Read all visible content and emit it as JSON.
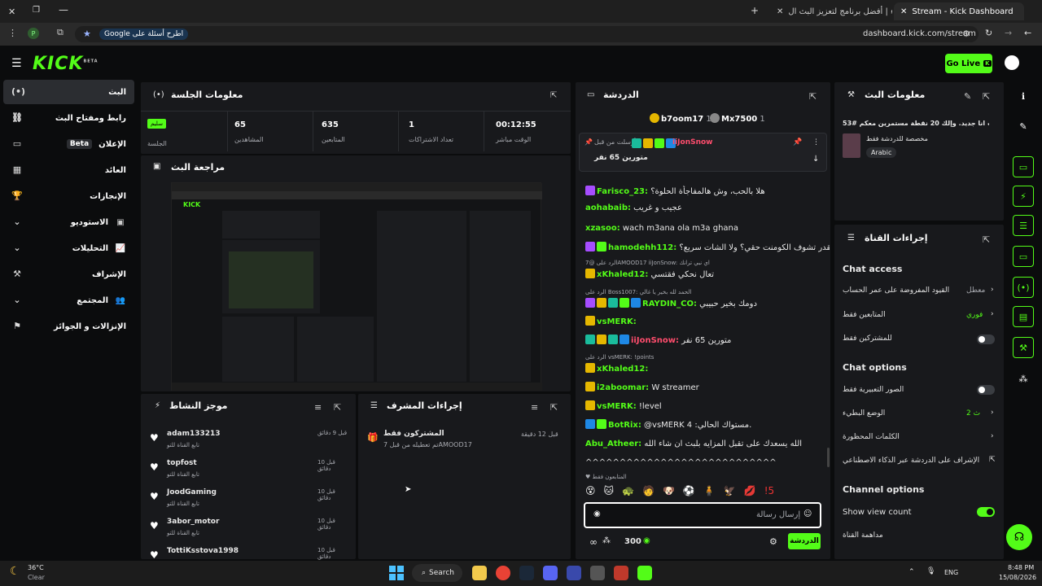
{
  "browser": {
    "tabs": [
      {
        "label": "Stream - Kick Dashboard",
        "active": true
      },
      {
        "label": "الولاء | أفضل برنامج لتعزيز البث ال",
        "active": false
      }
    ],
    "url": "dashboard.kick.com/stream",
    "search_chip": "Google اطرح أسئلة على",
    "profile_initial": "P"
  },
  "header": {
    "logo": "KICK",
    "logo_sup": "BETA",
    "go_live": "Go Live"
  },
  "sidebar": {
    "items": [
      {
        "label": "البث",
        "active": true
      },
      {
        "label": "رابط ومفتاح البث"
      },
      {
        "label": "الإعلان",
        "badge": "Beta"
      },
      {
        "label": "العائد"
      },
      {
        "label": "الإنجازات"
      },
      {
        "label": "الاستوديو"
      },
      {
        "label": "التحليلات"
      },
      {
        "label": "الإشراف"
      },
      {
        "label": "المجتمع"
      },
      {
        "label": "الإنزالات و الجوائز"
      }
    ]
  },
  "session": {
    "title": "معلومات الجلسة",
    "status_badge": "سليم",
    "status_label": "الجلسة",
    "stats": [
      {
        "value": "00:12:55",
        "label": "الوقت مباشر"
      },
      {
        "value": "1",
        "label": "تعداد الاشتراكات"
      },
      {
        "value": "635",
        "label": "المتابعين"
      },
      {
        "value": "65",
        "label": "المشاهدين"
      }
    ]
  },
  "preview": {
    "title": "مراجعة البث"
  },
  "activity": {
    "title": "موجز النشاط",
    "items": [
      {
        "user": "adam133213",
        "action": "تابع القناة للتو",
        "time": "قبل 9 دقائق"
      },
      {
        "user": "topfost",
        "action": "تابع القناة للتو",
        "time": "قبل 10 دقائق"
      },
      {
        "user": "JoodGaming",
        "action": "تابع القناة للتو",
        "time": "قبل 10 دقائق"
      },
      {
        "user": "3abor_motor",
        "action": "تابع القناة للتو",
        "time": "قبل 10 دقائق"
      },
      {
        "user": "TottiKsstova1998",
        "action": "",
        "time": "قبل 10 دقائق"
      }
    ]
  },
  "modactions": {
    "title": "إجراءات المشرف",
    "items": [
      {
        "title": "المشتركون فقط",
        "sub": "تم تعطيله من قبل 7AMOOD17",
        "time": "قبل 12 دقيقة"
      }
    ]
  },
  "chat": {
    "title": "الدردشة",
    "top_users": [
      {
        "name": "b7oom17",
        "count": "1"
      },
      {
        "name": "Mx7500",
        "count": "1"
      }
    ],
    "pinned": {
      "user": "iiJonSnow",
      "by": "أرسلت من قبل",
      "text": "متورين 65 نفر"
    },
    "messages": [
      {
        "user": "Farisco_23:",
        "text": "هلا بالحب، وش هالمفاجأة الحلوة؟",
        "color": "green"
      },
      {
        "user": "aohabaib:",
        "text": "عجيب و غريب",
        "color": "green"
      },
      {
        "user": "xzasoo:",
        "text": "wach m3ana ola m3a ghana",
        "color": "green"
      },
      {
        "user": "hamodehh112:",
        "text": "تقدر تشوف الكومنت حقي؟ ولا الشات سريع؟",
        "color": "green"
      },
      {
        "reply": "الرد على @7AMOOD17 iiJonSnow: اي نبي ترانك",
        "user": "xKhaled12:",
        "text": "تعال نحكي فقتسي",
        "color": "green"
      },
      {
        "reply": "الرد على Boss1007: الحمد لله بخير يا غالي",
        "user": "RAYDIN_CO:",
        "text": "دومك بخير حبيبي",
        "color": "green"
      },
      {
        "user": "vsMERK:",
        "text": "",
        "color": "green"
      },
      {
        "user": "iiJonSnow:",
        "text": "متورين 65 نفر",
        "color": "red"
      },
      {
        "reply": "الرد على vsMERK: !points",
        "user": "xKhaled12:",
        "text": "",
        "color": "green"
      },
      {
        "user": "i2aboomar:",
        "text": "W streamer",
        "color": "green"
      },
      {
        "user": "vsMERK:",
        "text": "!level",
        "color": "green"
      },
      {
        "user": "BotRix:",
        "text": "@vsMERK 4 :مستواك الحالي.",
        "color": "green"
      },
      {
        "user": "Abu_Atheer:",
        "text": "الله يسعدك على تقبل المزايه بلبث ان شاء الله",
        "color": "green"
      },
      {
        "user": "",
        "text": "^^^^^^^^^^^^^^^^^^^^^^^^^^^^",
        "color": "white"
      }
    ],
    "followers_only": "المتابعون فقط",
    "input_placeholder": "إرسال رسالة",
    "points": "300",
    "send_label": "الدردشة"
  },
  "stream_info": {
    "title": "معلومات البث",
    "stream_title": "اكتب انا جديد. وإلك 20 نقطة مستمرين معكم #53",
    "category": "مخصصة للدردشة فقط",
    "language": "Arabic"
  },
  "channel_actions": {
    "title": "إجراءات القناة",
    "chat_access_header": "Chat access",
    "chat_access": [
      {
        "label": "القيود المفروضة على عمر الحساب",
        "value": "معطل"
      },
      {
        "label": "المتابعين فقط",
        "value": "فوري"
      },
      {
        "label": "للمشتركين فقط",
        "toggle": false
      }
    ],
    "chat_options_header": "Chat options",
    "chat_options": [
      {
        "label": "الصور التعبيرية فقط",
        "toggle": false
      },
      {
        "label": "الوضع البطيء",
        "value": "2 ث"
      },
      {
        "label": "الكلمات المحظورة",
        "value": ""
      },
      {
        "label": "الإشراف على الدردشة عبر الذكاء الاصطناعي",
        "value": ""
      }
    ],
    "channel_options_header": "Channel options",
    "channel_options": [
      {
        "label": "Show view count",
        "toggle": true
      },
      {
        "label": "مداهمة القناة",
        "value": ""
      }
    ]
  },
  "taskbar": {
    "weather_temp": "36°C",
    "weather_desc": "Clear",
    "search": "Search",
    "lang": "ENG",
    "time": "8:48 PM",
    "date": "15/08/2026"
  },
  "colors": {
    "accent": "#53fc18",
    "panel": "#18191c",
    "bg": "#0b0c0d"
  }
}
